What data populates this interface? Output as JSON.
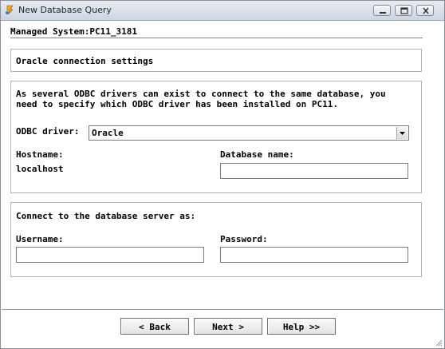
{
  "window": {
    "title": "New Database Query"
  },
  "header": {
    "managed_system": "Managed System:PC11_3181"
  },
  "section_title": "Oracle connection settings",
  "driver_panel": {
    "description_line1": "As several ODBC drivers can exist to connect to the same database, you",
    "description_line2": "need to specify which ODBC driver has been installed on PC11.",
    "odbc_label": "ODBC driver:",
    "odbc_value": "Oracle",
    "hostname_label": "Hostname:",
    "hostname_value": "localhost",
    "dbname_label": "Database name:",
    "dbname_value": ""
  },
  "credentials_panel": {
    "heading": "Connect to the database server as:",
    "username_label": "Username:",
    "username_value": "",
    "password_label": "Password:",
    "password_value": ""
  },
  "buttons": {
    "back": "< Back",
    "next": "Next >",
    "help": "Help >>"
  },
  "colors": {
    "titlebar_start": "#e7ebf0",
    "titlebar_end": "#cdd5df",
    "panel_border": "#b4b4b4"
  }
}
